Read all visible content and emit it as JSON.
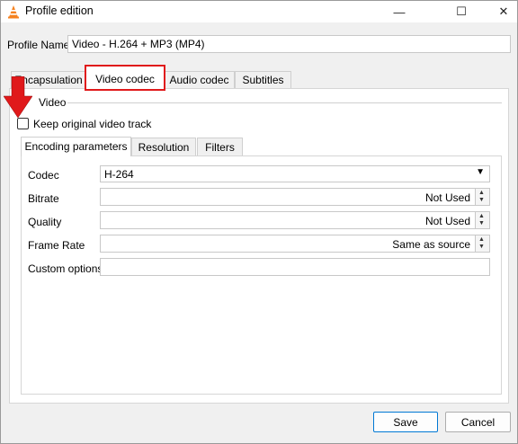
{
  "window": {
    "title": "Profile edition",
    "minimize_glyph": "—",
    "maximize_glyph": "☐",
    "close_glyph": "✕"
  },
  "profile": {
    "label": "Profile Name",
    "value": "Video - H.264 + MP3 (MP4)"
  },
  "tabs": [
    {
      "label": "Encapsulation"
    },
    {
      "label": "Video codec"
    },
    {
      "label": "Audio codec"
    },
    {
      "label": "Subtitles"
    }
  ],
  "video_group": {
    "title": "Video",
    "keep_original_label": "Keep original video track",
    "keep_original_checked": false
  },
  "inner_tabs": [
    {
      "label": "Encoding parameters"
    },
    {
      "label": "Resolution"
    },
    {
      "label": "Filters"
    }
  ],
  "fields": {
    "codec": {
      "label": "Codec",
      "value": "H-264"
    },
    "bitrate": {
      "label": "Bitrate",
      "value": "Not Used"
    },
    "quality": {
      "label": "Quality",
      "value": "Not Used"
    },
    "frame_rate": {
      "label": "Frame Rate",
      "value": "Same as source"
    },
    "custom_options": {
      "label": "Custom options",
      "value": ""
    }
  },
  "buttons": {
    "save": "Save",
    "cancel": "Cancel"
  },
  "annotation": {
    "highlight_color": "#e0191b",
    "arrow_color": "#e0191b"
  }
}
